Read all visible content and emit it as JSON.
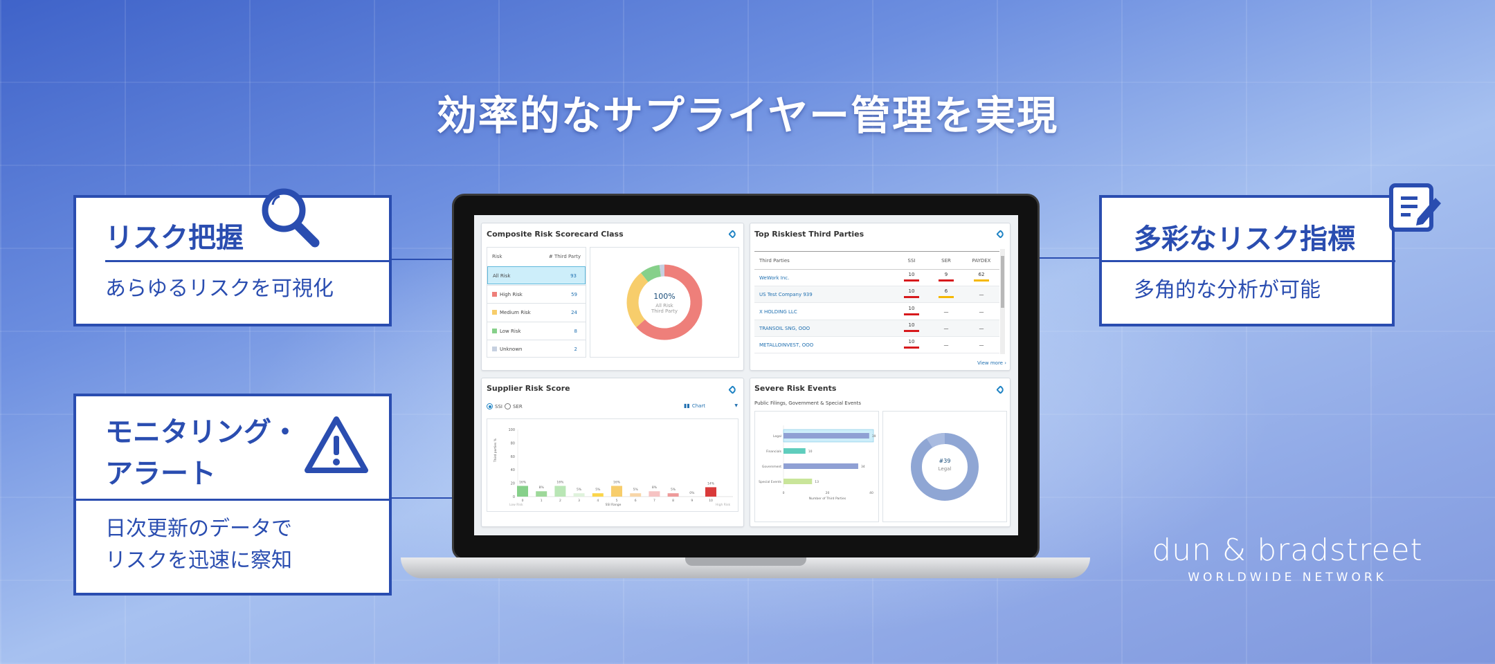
{
  "headline": "効率的なサプライヤー管理を実現",
  "features": [
    {
      "title": [
        "リスク把握"
      ],
      "desc": [
        "あらゆるリスクを可視化"
      ],
      "icon": "magnifier-icon"
    },
    {
      "title": [
        "モニタリング・",
        "アラート"
      ],
      "desc": [
        "日次更新のデータで",
        "リスクを迅速に察知"
      ],
      "icon": "warning-icon"
    },
    {
      "title": [
        "多彩なリスク指標"
      ],
      "desc": [
        "多角的な分析が可能"
      ],
      "icon": "document-edit-icon"
    }
  ],
  "dashboard": {
    "composite": {
      "title": "Composite Risk Scorecard Class",
      "col_risk": "Risk",
      "col_count": "# Third Party",
      "rows": [
        {
          "label": "All Risk",
          "count": "93",
          "color": null
        },
        {
          "label": "High Risk",
          "count": "59",
          "color": "#ee7f7a"
        },
        {
          "label": "Medium Risk",
          "count": "24",
          "color": "#f7cd6b"
        },
        {
          "label": "Low Risk",
          "count": "8",
          "color": "#86d08a"
        },
        {
          "label": "Unknown",
          "count": "2",
          "color": "#c6d0e0"
        }
      ],
      "center_value": "100%",
      "center_label1": "All Risk",
      "center_label2": "Third Party"
    },
    "top_riskiest": {
      "title": "Top Riskiest Third Parties",
      "columns": [
        "Third Parties",
        "SSI",
        "SER",
        "PAYDEX"
      ],
      "rows": [
        {
          "name": "WeWork Inc.",
          "ssi": "10",
          "ser": "9",
          "paydex": "62",
          "ssi_color": "#d7191c",
          "ser_color": "#d7191c",
          "paydex_color": "#f5b800"
        },
        {
          "name": "US Test Company 939",
          "ssi": "10",
          "ser": "6",
          "paydex": "—",
          "ssi_color": "#d7191c",
          "ser_color": "#f5b800",
          "paydex_color": null
        },
        {
          "name": "X HOLDING LLC",
          "ssi": "10",
          "ser": "—",
          "paydex": "—",
          "ssi_color": "#d7191c",
          "ser_color": null,
          "paydex_color": null
        },
        {
          "name": "TRANSOIL SNG, OOO",
          "ssi": "10",
          "ser": "—",
          "paydex": "—",
          "ssi_color": "#d7191c",
          "ser_color": null,
          "paydex_color": null
        },
        {
          "name": "METALLOINVEST, OOO",
          "ssi": "10",
          "ser": "—",
          "paydex": "—",
          "ssi_color": "#d7191c",
          "ser_color": null,
          "paydex_color": null
        }
      ],
      "view_more": "View more"
    },
    "supplier": {
      "title": "Supplier Risk Score",
      "radio_options": [
        "SSI",
        "SER"
      ],
      "radio_selected": "SSI",
      "view_select": "Chart"
    },
    "severe": {
      "title": "Severe Risk Events",
      "subtitle": "Public Filings, Government & Special Events",
      "center_value": "#39",
      "center_label": "Legal"
    }
  },
  "chart_data": [
    {
      "type": "pie",
      "categories": [
        "High Risk",
        "Medium Risk",
        "Low Risk",
        "Unknown"
      ],
      "values": [
        59,
        24,
        8,
        2
      ],
      "colors": [
        "#ee7f7a",
        "#f7cd6b",
        "#86d08a",
        "#c6d0e0"
      ],
      "donut": true
    },
    {
      "type": "bar",
      "categories": [
        "0",
        "1",
        "2",
        "3",
        "4",
        "5",
        "6",
        "7",
        "8",
        "9",
        "10"
      ],
      "values": [
        16,
        8,
        16,
        5,
        5,
        16,
        5,
        8,
        5,
        0,
        14
      ],
      "labels": [
        "16%",
        "8%",
        "16%",
        "5%",
        "5%",
        "16%",
        "5%",
        "8%",
        "5%",
        "0%",
        "14%"
      ],
      "colors": [
        "#86d08a",
        "#9ed89a",
        "#b9e6b5",
        "#dff2dc",
        "#fbd54a",
        "#f7cd6b",
        "#f8d6a8",
        "#f6c3c3",
        "#ee9a9a",
        "#eeeeee",
        "#d93a3a"
      ],
      "ylabel": "Third parties %",
      "xlabel": "SSI Range",
      "x_left_note": "Low Risk",
      "x_right_note": "High Risk",
      "ylim": [
        0,
        100
      ],
      "yticks": [
        0,
        20,
        40,
        60,
        80,
        100
      ]
    },
    {
      "type": "bar",
      "orientation": "horizontal",
      "categories": [
        "Legal",
        "Financials",
        "Government",
        "Special Events"
      ],
      "values": [
        39,
        10,
        34,
        13
      ],
      "colors": [
        "#8fa0d4",
        "#5fcdbd",
        "#8fa0d4",
        "#c9e59a"
      ],
      "xlabel": "Number of Third Parties",
      "xlim": [
        0,
        40
      ],
      "xticks": [
        0,
        20,
        40
      ],
      "highlight": "Legal"
    }
  ],
  "logo": {
    "main": "dun & bradstreet",
    "sub": "WORLDWIDE NETWORK"
  }
}
